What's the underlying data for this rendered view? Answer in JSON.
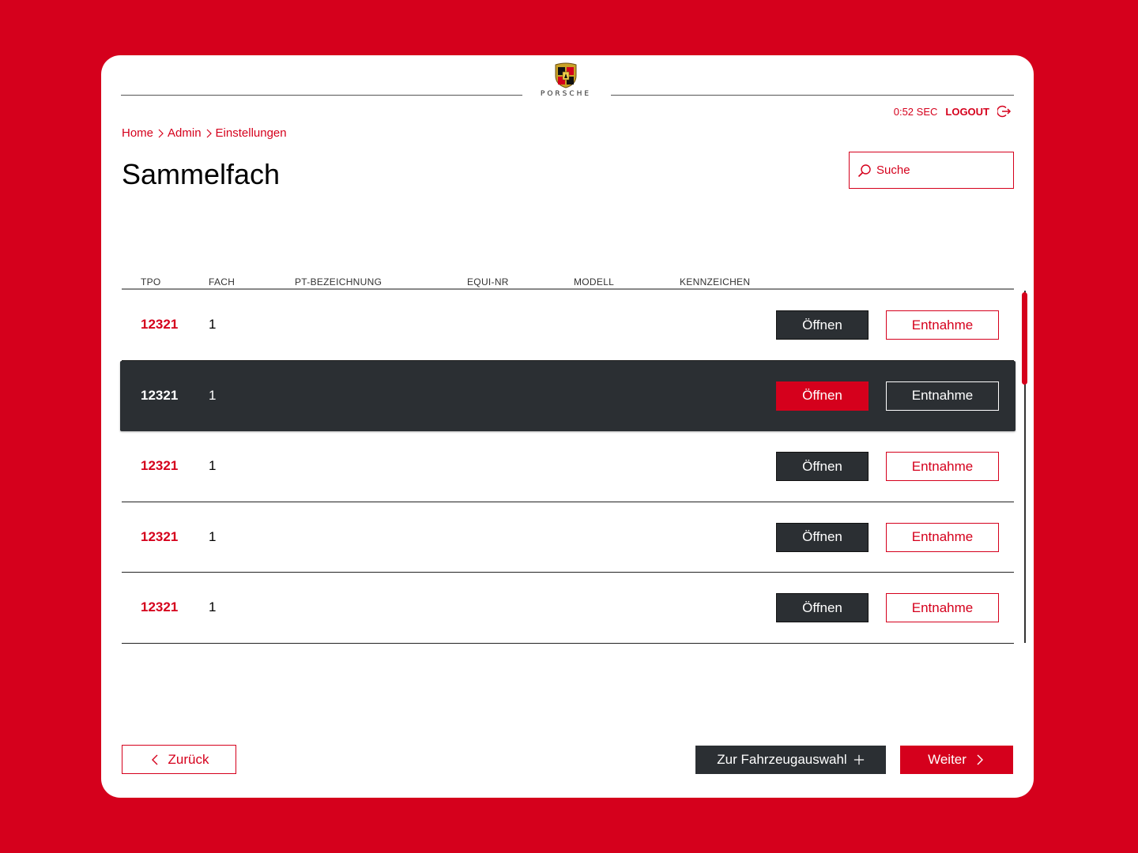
{
  "brand": {
    "wordmark": "PORSCHE"
  },
  "session": {
    "timer": "0:52 SEC",
    "logout_label": "LOGOUT"
  },
  "breadcrumb": [
    "Home",
    "Admin",
    "Einstellungen"
  ],
  "page": {
    "title": "Sammelfach"
  },
  "search": {
    "placeholder": "Suche"
  },
  "table": {
    "columns": [
      "TPO",
      "FACH",
      "PT-BEZEICHNUNG",
      "EQUI-NR",
      "MODELL",
      "KENNZEICHEN"
    ],
    "rows": [
      {
        "tpo": "12321",
        "fach": "1",
        "open_label": "Öffnen",
        "take_label": "Entnahme",
        "selected": false
      },
      {
        "tpo": "12321",
        "fach": "1",
        "open_label": "Öffnen",
        "take_label": "Entnahme",
        "selected": true
      },
      {
        "tpo": "12321",
        "fach": "1",
        "open_label": "Öffnen",
        "take_label": "Entnahme",
        "selected": false
      },
      {
        "tpo": "12321",
        "fach": "1",
        "open_label": "Öffnen",
        "take_label": "Entnahme",
        "selected": false
      },
      {
        "tpo": "12321",
        "fach": "1",
        "open_label": "Öffnen",
        "take_label": "Entnahme",
        "selected": false
      }
    ]
  },
  "footer": {
    "back_label": "Zurück",
    "vehicle_label": "Zur Fahrzeugauswahl",
    "next_label": "Weiter"
  },
  "colors": {
    "accent": "#d5001c",
    "dark": "#2b2f33",
    "background": "#ffffff"
  },
  "icons": [
    "porsche-crest-icon",
    "logout-icon",
    "chevron-right-icon",
    "search-icon",
    "chevron-left-icon",
    "plus-icon"
  ]
}
